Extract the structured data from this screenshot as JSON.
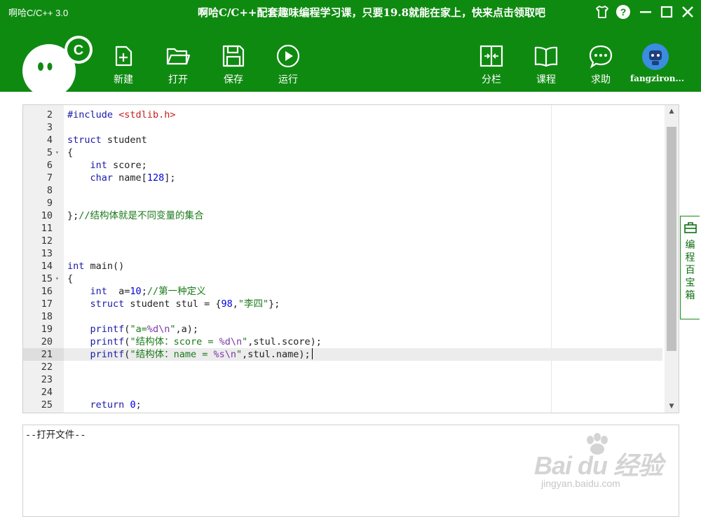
{
  "window": {
    "title": "啊哈C/C++ 3.0",
    "promo": "啊哈C/C++配套趣味编程学习课，只要19.8就能在家上，快来点击领取吧",
    "controls": [
      "skin-icon",
      "help-icon",
      "minimize-icon",
      "maximize-icon",
      "close-icon"
    ]
  },
  "toolbar": {
    "new_label": "新建",
    "open_label": "打开",
    "save_label": "保存",
    "run_label": "运行",
    "split_label": "分栏",
    "course_label": "课程",
    "help_label": "求助",
    "user_name": "fangziron..."
  },
  "colors": {
    "brand_green": "#0f8a11",
    "keyword": "#1a1aa8",
    "string": "#1a7a1a",
    "number": "#0000dd",
    "include": "#c81e1e"
  },
  "editor": {
    "lines": [
      {
        "n": "2",
        "fold": "",
        "html": "<span class=\"kw\">#include</span> <span class=\"inc\">&lt;stdlib.h&gt;</span>"
      },
      {
        "n": "3",
        "fold": "",
        "html": ""
      },
      {
        "n": "4",
        "fold": "",
        "html": "<span class=\"kw\">struct</span> student"
      },
      {
        "n": "5",
        "fold": "▾",
        "html": "{"
      },
      {
        "n": "6",
        "fold": "",
        "html": "    <span class=\"kw\">int</span> score;"
      },
      {
        "n": "7",
        "fold": "",
        "html": "    <span class=\"kw\">char</span> name[<span class=\"num\">128</span>];"
      },
      {
        "n": "8",
        "fold": "",
        "html": ""
      },
      {
        "n": "9",
        "fold": "",
        "html": ""
      },
      {
        "n": "10",
        "fold": "",
        "html": "};<span class=\"cmt\">//结构体就是不同变量的集合</span>"
      },
      {
        "n": "11",
        "fold": "",
        "html": ""
      },
      {
        "n": "12",
        "fold": "",
        "html": ""
      },
      {
        "n": "13",
        "fold": "",
        "html": ""
      },
      {
        "n": "14",
        "fold": "",
        "html": "<span class=\"kw\">int</span> main()"
      },
      {
        "n": "15",
        "fold": "▾",
        "html": "{"
      },
      {
        "n": "16",
        "fold": "",
        "html": "    <span class=\"kw\">int</span>  a=<span class=\"num\">10</span>;<span class=\"cmt\">//第一种定义</span>"
      },
      {
        "n": "17",
        "fold": "",
        "html": "    <span class=\"kw\">struct</span> student stul = {<span class=\"num\">98</span>,<span class=\"str\">\"李四\"</span>};"
      },
      {
        "n": "18",
        "fold": "",
        "html": ""
      },
      {
        "n": "19",
        "fold": "",
        "html": "    <span class=\"kw\">printf</span>(<span class=\"str\">\"a=<span class=\"fmt\">%d\\n</span>\"</span>,a);"
      },
      {
        "n": "20",
        "fold": "",
        "html": "    <span class=\"kw\">printf</span>(<span class=\"str\">\"结构体：score = <span class=\"fmt\">%d\\n</span>\"</span>,stul.score);"
      },
      {
        "n": "21",
        "fold": "",
        "active": true,
        "html": "    <span class=\"kw\">printf</span>(<span class=\"str\">\"结构体：name = <span class=\"fmt\">%s\\n</span>\"</span>,stul.name);<span class=\"caret\"></span>"
      },
      {
        "n": "22",
        "fold": "",
        "html": ""
      },
      {
        "n": "23",
        "fold": "",
        "html": ""
      },
      {
        "n": "24",
        "fold": "",
        "html": ""
      },
      {
        "n": "25",
        "fold": "",
        "html": "    <span class=\"kw\">return</span> <span class=\"num\">0</span>;"
      }
    ]
  },
  "side_panel": {
    "label": "编程百宝箱"
  },
  "output": {
    "text": "--打开文件--"
  },
  "watermark": {
    "main": "Bai du 经验",
    "sub": "jingyan.baidu.com"
  }
}
